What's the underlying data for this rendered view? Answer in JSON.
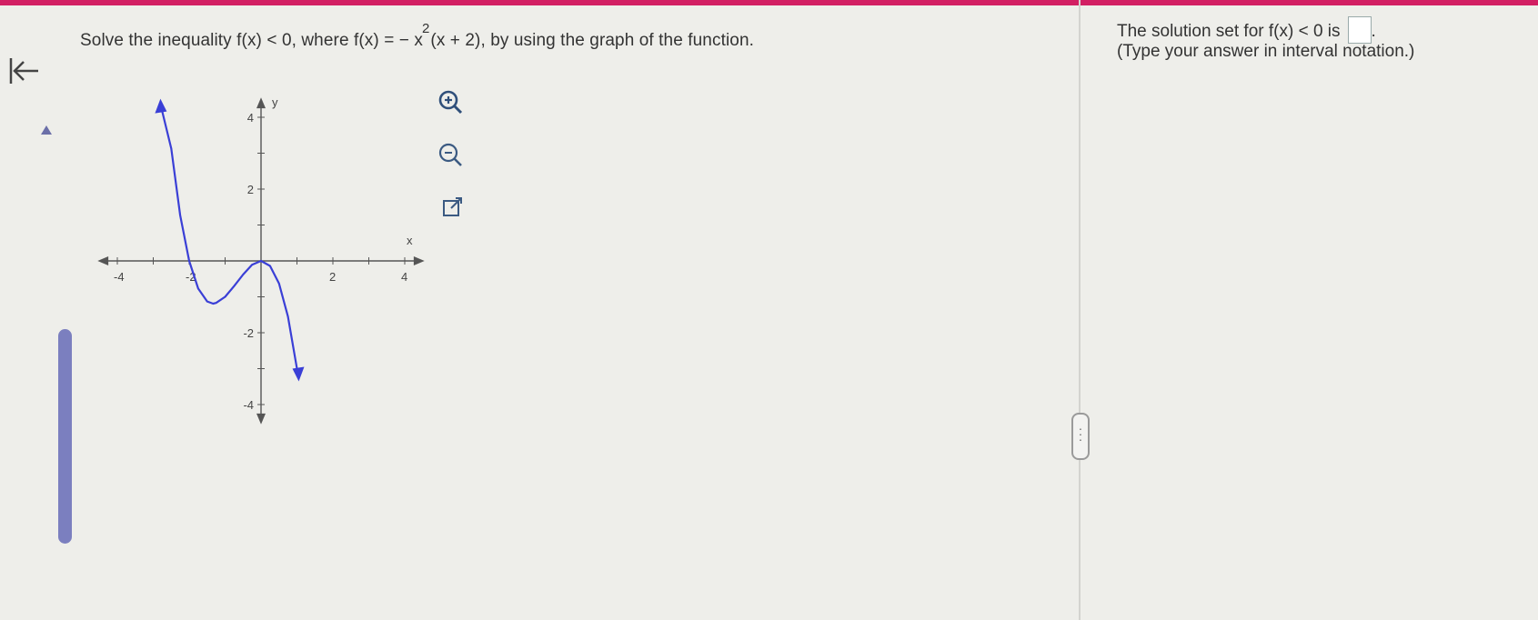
{
  "colors": {
    "accent_top": "#d21f63",
    "curve": "#3a3fd6",
    "scrollbar": "#7b7fbf",
    "axis": "#555555"
  },
  "question": {
    "prefix": "Solve the inequality f(x) < 0, where f(x) = − x",
    "exponent": "2",
    "suffix": "(x + 2), by using the graph of the function."
  },
  "toolbar": {
    "back_icon": "arrow-left-bar-icon",
    "zoom_in_icon": "zoom-in-icon",
    "zoom_out_icon": "zoom-out-icon",
    "popout_icon": "external-link-icon"
  },
  "graph": {
    "x_axis_label": "x",
    "y_axis_label": "y",
    "x_ticks": [
      "-4",
      "-2",
      "2",
      "4"
    ],
    "y_ticks": [
      "4",
      "2",
      "-2",
      "-4"
    ],
    "x_range": [
      -4.5,
      4.5
    ],
    "y_range": [
      -4.5,
      4.5
    ]
  },
  "chart_data": {
    "type": "line",
    "function": "f(x) = -x^2(x + 2)",
    "x": [
      -2.75,
      -2.5,
      -2.25,
      -2,
      -1.75,
      -1.5,
      -1.333,
      -1.25,
      -1,
      -0.75,
      -0.5,
      -0.25,
      0,
      0.25,
      0.5,
      0.75,
      1.0
    ],
    "y": [
      4.16,
      3.13,
      1.27,
      0,
      -0.77,
      -1.13,
      -1.19,
      -1.17,
      -1.0,
      -0.7,
      -0.38,
      -0.11,
      0,
      -0.14,
      -0.63,
      -1.55,
      -3.0
    ],
    "xlim": [
      -4.5,
      4.5
    ],
    "ylim": [
      -4.5,
      4.5
    ],
    "grid": false,
    "xlabel": "x",
    "ylabel": "y"
  },
  "answer": {
    "line1_prefix": "The solution set for f(x) < 0 is",
    "line1_suffix": ".",
    "instruction": "(Type your answer in interval notation.)",
    "input_value": ""
  }
}
